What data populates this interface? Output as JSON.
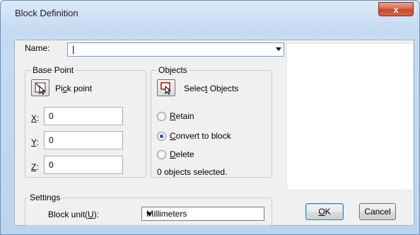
{
  "window": {
    "title": "Block Definition",
    "close_glyph": "x"
  },
  "name": {
    "label": "Name:",
    "value": "|"
  },
  "base_point": {
    "legend": "Base Point",
    "pick_point": {
      "pre": "Pi",
      "u": "c",
      "post": "k point"
    },
    "x": {
      "label_u": "X",
      "label_rest": ":",
      "value": "0"
    },
    "y": {
      "label_u": "Y",
      "label_rest": ":",
      "value": "0"
    },
    "z": {
      "label_u": "Z",
      "label_rest": ":",
      "value": "0"
    }
  },
  "objects": {
    "legend": "Objects",
    "select_objects": {
      "pre": "Selec",
      "u": "t",
      "post": " Objects"
    },
    "retain": {
      "u": "R",
      "post": "etain",
      "checked": false
    },
    "convert": {
      "u": "C",
      "post": "onvert to block",
      "checked": true
    },
    "delete": {
      "u": "D",
      "post": "elete",
      "checked": false
    },
    "status": "0 objects selected."
  },
  "settings": {
    "legend": "Settings",
    "block_unit_label": {
      "pre": "Block unit(",
      "u": "U",
      "post": "):"
    },
    "block_unit_value": "Millimeters"
  },
  "buttons": {
    "ok": {
      "u": "O",
      "post": "K"
    },
    "cancel": "Cancel"
  },
  "icons": {
    "pick_point": "pick-point-icon",
    "select_objects": "select-objects-icon",
    "close": "close-icon",
    "dropdown": "chevron-down-icon"
  }
}
